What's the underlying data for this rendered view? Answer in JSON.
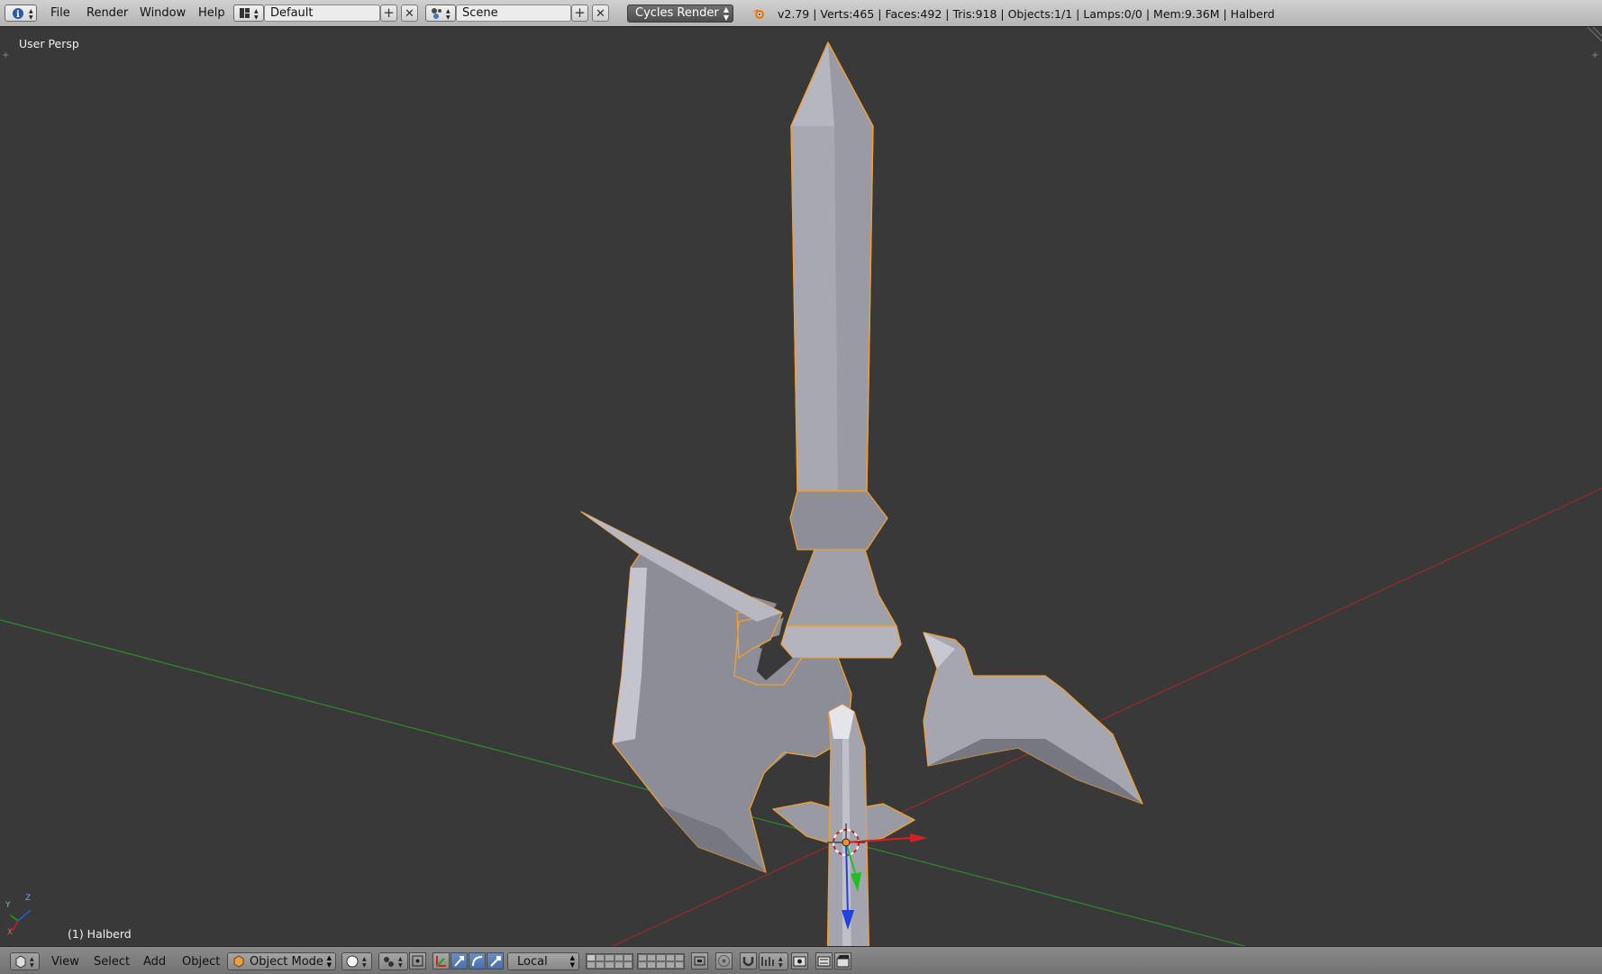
{
  "top_menu": {
    "items": [
      "File",
      "Render",
      "Window",
      "Help"
    ]
  },
  "screen_layout": {
    "value": "Default"
  },
  "scene": {
    "value": "Scene"
  },
  "render_engine": {
    "value": "Cycles Render"
  },
  "stats": {
    "text": "v2.79 | Verts:465 | Faces:492 | Tris:918 | Objects:1/1 | Lamps:0/0 | Mem:9.36M | Halberd"
  },
  "viewport": {
    "view_label": "User Persp",
    "object_label": "(1) Halberd",
    "axis_x": "X",
    "axis_y": "Y",
    "axis_z": "Z"
  },
  "bottom_menu": {
    "items": [
      "View",
      "Select",
      "Add",
      "Object"
    ],
    "mode": "Object Mode",
    "orientation": "Local"
  },
  "colors": {
    "viewport_bg": "#393939",
    "selection_outline": "#f0a030",
    "x_axis": "#b02020",
    "y_axis": "#20a020",
    "mesh_light": "#c8c8d0",
    "mesh_mid": "#9a9aa4",
    "mesh_dark": "#6e6e7a"
  }
}
